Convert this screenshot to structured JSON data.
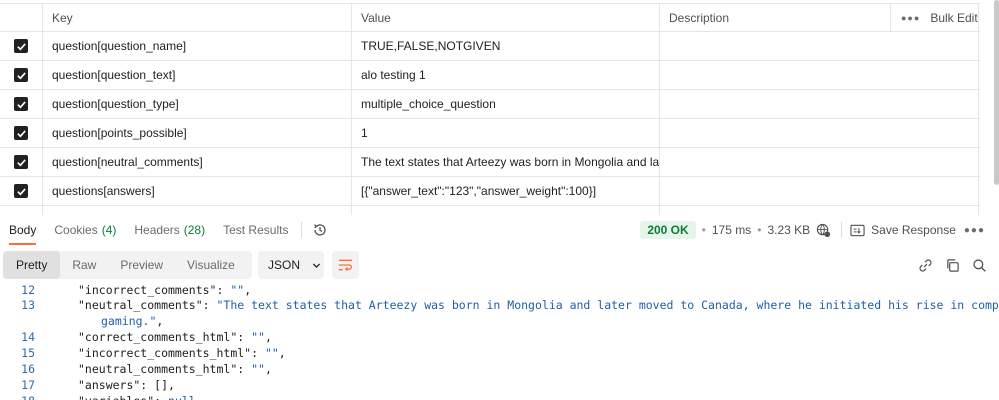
{
  "params": {
    "header": {
      "key": "Key",
      "value": "Value",
      "description": "Description",
      "bulk_edit": "Bulk Edit"
    },
    "rows": [
      {
        "key": "question[question_name]",
        "value": "TRUE,FALSE,NOTGIVEN",
        "description": ""
      },
      {
        "key": "question[question_text]",
        "value": "alo testing 1",
        "description": ""
      },
      {
        "key": "question[question_type]",
        "value": "multiple_choice_question",
        "description": ""
      },
      {
        "key": "question[points_possible]",
        "value": "1",
        "description": ""
      },
      {
        "key": "question[neutral_comments]",
        "value": "The text states that Arteezy was born in Mongolia and lat...",
        "description": ""
      },
      {
        "key": "questions[answers]",
        "value": "[{\"answer_text\":\"123\",\"answer_weight\":100}]",
        "description": ""
      }
    ]
  },
  "response": {
    "tabs": [
      {
        "label": "Body",
        "count": ""
      },
      {
        "label": "Cookies",
        "count": "(4)"
      },
      {
        "label": "Headers",
        "count": "(28)"
      },
      {
        "label": "Test Results",
        "count": ""
      }
    ],
    "status": "200 OK",
    "time": "175 ms",
    "size": "3.23 KB",
    "save_label": "Save Response"
  },
  "toolbar": {
    "formats": [
      "Pretty",
      "Raw",
      "Preview",
      "Visualize"
    ],
    "language": "JSON"
  },
  "code": {
    "lines": [
      {
        "n": "12",
        "key": "\"incorrect_comments\": ",
        "val": "\"\"",
        "tail": ","
      },
      {
        "n": "13",
        "key": "\"neutral_comments\": ",
        "val": "\"The text states that Arteezy was born in Mongolia and later moved to Canada, where he initiated his rise in competitive",
        "tail": ""
      },
      {
        "n": "",
        "key": "",
        "val": "gaming.\"",
        "tail": ","
      },
      {
        "n": "14",
        "key": "\"correct_comments_html\": ",
        "val": "\"\"",
        "tail": ","
      },
      {
        "n": "15",
        "key": "\"incorrect_comments_html\": ",
        "val": "\"\"",
        "tail": ","
      },
      {
        "n": "16",
        "key": "\"neutral_comments_html\": ",
        "val": "\"\"",
        "tail": ","
      },
      {
        "n": "17",
        "key": "\"answers\": ",
        "val": "[]",
        "tail": ","
      },
      {
        "n": "18",
        "key": "\"variables\": ",
        "val": "null",
        "tail": ""
      }
    ]
  },
  "colors": {
    "accent": "#ff6c37",
    "status_green": "#0a7d3a",
    "string_blue": "#1f5fa8"
  }
}
